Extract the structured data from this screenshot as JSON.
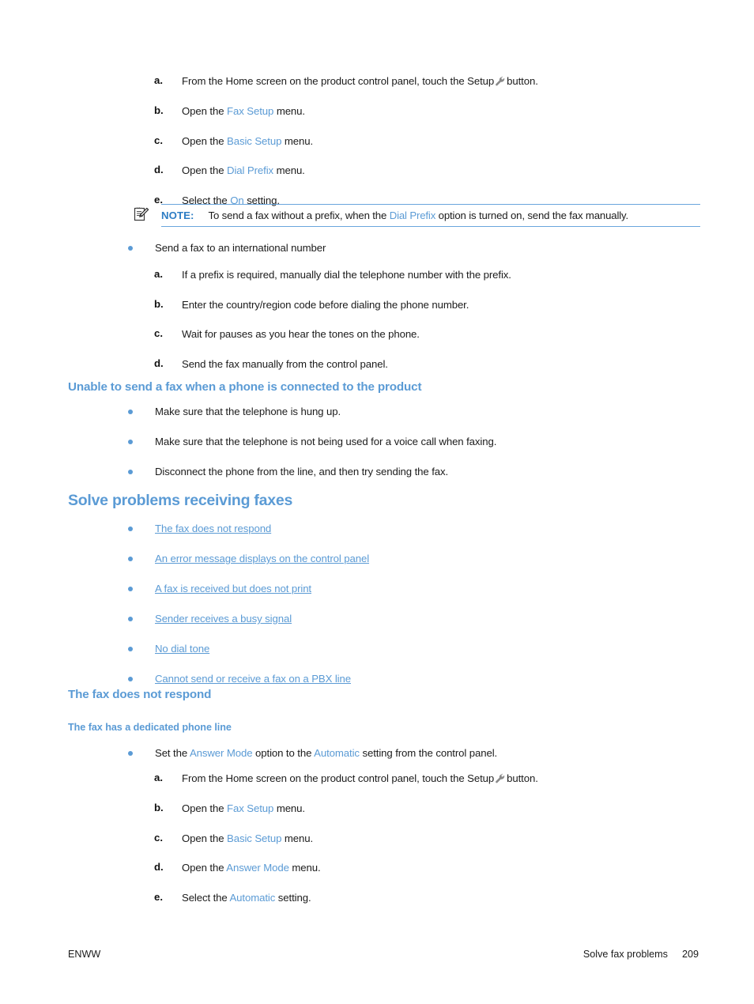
{
  "document": {
    "footer_left": "ENWW",
    "footer_chapter": "Solve fax problems",
    "footer_page": "209"
  },
  "colors": {
    "heading_blue": "#5b9bd5",
    "link_blue": "#5b9bd5",
    "note_label_blue": "#2e7dc4",
    "note_rule_blue": "#6aa6dd",
    "body_text": "#1b1b1b",
    "wrench_gray": "#8a8a8a"
  },
  "dial_prefix_steps": [
    {
      "marker": "a.",
      "pre": "From the Home screen on the product control panel, touch the Setup",
      "icon": "wrench-icon",
      "post": "button."
    },
    {
      "marker": "b.",
      "pre": "Open the ",
      "term": "Fax Setup",
      "post": " menu."
    },
    {
      "marker": "c.",
      "pre": "Open the ",
      "term": "Basic Setup",
      "post": " menu."
    },
    {
      "marker": "d.",
      "pre": "Open the ",
      "term": "Dial Prefix",
      "post": " menu."
    },
    {
      "marker": "e.",
      "pre": "Select the ",
      "term": "On",
      "post": " setting."
    }
  ],
  "note": {
    "icon": "note-pencil-icon",
    "label": "NOTE:",
    "pre": "To send a fax without a prefix, when the ",
    "term": "Dial Prefix",
    "post": " option is turned on, send the fax manually."
  },
  "international": {
    "bullet_text": "Send a fax to an international number",
    "steps": [
      {
        "marker": "a.",
        "text": "If a prefix is required, manually dial the telephone number with the prefix."
      },
      {
        "marker": "b.",
        "text": "Enter the country/region code before dialing the phone number."
      },
      {
        "marker": "c.",
        "text": "Wait for pauses as you hear the tones on the phone."
      },
      {
        "marker": "d.",
        "text": "Send the fax manually from the control panel."
      }
    ]
  },
  "phone_connected": {
    "heading": "Unable to send a fax when a phone is connected to the product",
    "bullets": [
      "Make sure that the telephone is hung up.",
      "Make sure that the telephone is not being used for a voice call when faxing.",
      "Disconnect the phone from the line, and then try sending the fax."
    ]
  },
  "receiving": {
    "heading": "Solve problems receiving faxes",
    "links": [
      "The fax does not respond",
      "An error message displays on the control panel",
      "A fax is received but does not print",
      "Sender receives a busy signal",
      "No dial tone",
      "Cannot send or receive a fax on a PBX line"
    ]
  },
  "fax_no_respond": {
    "heading": "The fax does not respond",
    "subheading": "The fax has a dedicated phone line",
    "bullet": {
      "pre": "Set the ",
      "term1": "Answer Mode",
      "mid": " option to the ",
      "term2": "Automatic",
      "post": " setting from the control panel."
    },
    "steps": [
      {
        "marker": "a.",
        "pre": "From the Home screen on the product control panel, touch the Setup",
        "icon": "wrench-icon",
        "post": "button."
      },
      {
        "marker": "b.",
        "pre": "Open the ",
        "term": "Fax Setup",
        "post": " menu."
      },
      {
        "marker": "c.",
        "pre": "Open the ",
        "term": "Basic Setup",
        "post": " menu."
      },
      {
        "marker": "d.",
        "pre": "Open the ",
        "term": "Answer Mode",
        "post": " menu."
      },
      {
        "marker": "e.",
        "pre": "Select the ",
        "term": "Automatic",
        "post": " setting."
      }
    ]
  }
}
